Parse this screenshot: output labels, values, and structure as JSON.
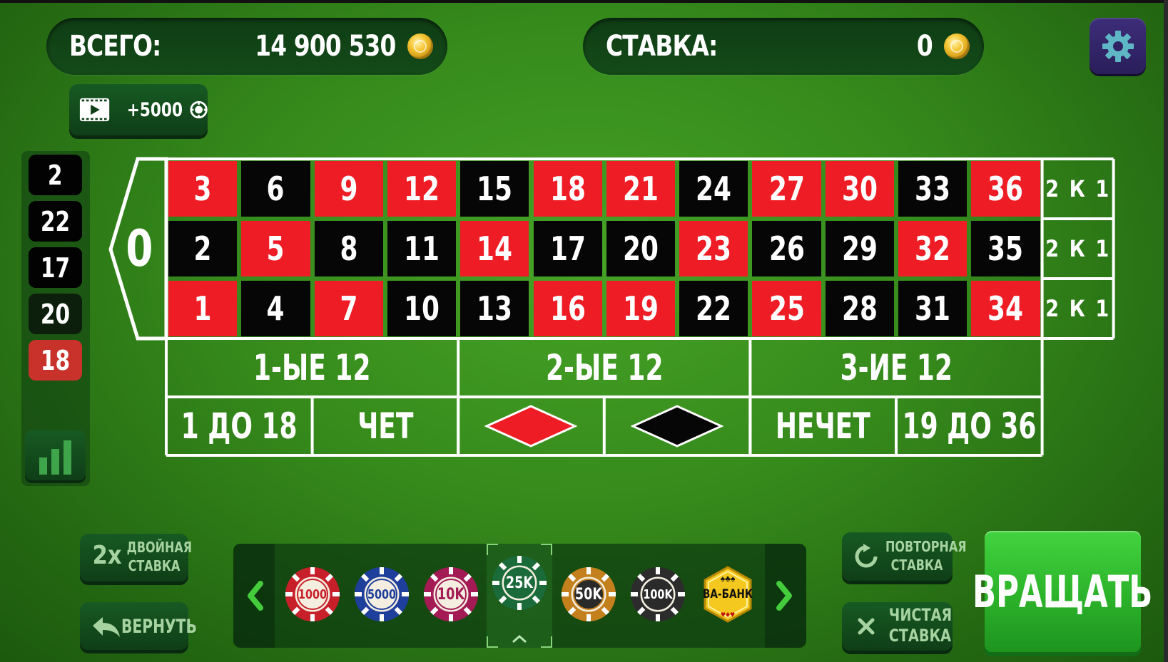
{
  "header": {
    "total_label": "ВСЕГО:",
    "total_value": "14 900 530",
    "bet_label": "СТАВКА:",
    "bet_value": "0"
  },
  "icons": {
    "settings": "gear-icon",
    "video": "video-play-icon",
    "chip_small": "chip-icon",
    "coin": "gold-coin-icon",
    "stats": "bar-chart-icon",
    "undo": "undo-arrow-icon",
    "repeat": "repeat-icon",
    "clear": "close-icon",
    "prev": "chevron-left-icon",
    "next": "chevron-right-icon",
    "up": "chevron-up-icon"
  },
  "reward": {
    "label": "+5000"
  },
  "history": [
    {
      "value": "2",
      "color": "black"
    },
    {
      "value": "22",
      "color": "black"
    },
    {
      "value": "17",
      "color": "black"
    },
    {
      "value": "20",
      "color": "black"
    },
    {
      "value": "18",
      "color": "red"
    }
  ],
  "board": {
    "zero": "0",
    "rows": [
      [
        {
          "n": "3",
          "c": "red"
        },
        {
          "n": "6",
          "c": "black"
        },
        {
          "n": "9",
          "c": "red"
        },
        {
          "n": "12",
          "c": "red"
        },
        {
          "n": "15",
          "c": "black"
        },
        {
          "n": "18",
          "c": "red"
        },
        {
          "n": "21",
          "c": "red"
        },
        {
          "n": "24",
          "c": "black"
        },
        {
          "n": "27",
          "c": "red"
        },
        {
          "n": "30",
          "c": "red"
        },
        {
          "n": "33",
          "c": "black"
        },
        {
          "n": "36",
          "c": "red"
        }
      ],
      [
        {
          "n": "2",
          "c": "black"
        },
        {
          "n": "5",
          "c": "red"
        },
        {
          "n": "8",
          "c": "black"
        },
        {
          "n": "11",
          "c": "black"
        },
        {
          "n": "14",
          "c": "red"
        },
        {
          "n": "17",
          "c": "black"
        },
        {
          "n": "20",
          "c": "black"
        },
        {
          "n": "23",
          "c": "red"
        },
        {
          "n": "26",
          "c": "black"
        },
        {
          "n": "29",
          "c": "black"
        },
        {
          "n": "32",
          "c": "red"
        },
        {
          "n": "35",
          "c": "black"
        }
      ],
      [
        {
          "n": "1",
          "c": "red"
        },
        {
          "n": "4",
          "c": "black"
        },
        {
          "n": "7",
          "c": "red"
        },
        {
          "n": "10",
          "c": "black"
        },
        {
          "n": "13",
          "c": "black"
        },
        {
          "n": "16",
          "c": "red"
        },
        {
          "n": "19",
          "c": "red"
        },
        {
          "n": "22",
          "c": "black"
        },
        {
          "n": "25",
          "c": "red"
        },
        {
          "n": "28",
          "c": "black"
        },
        {
          "n": "31",
          "c": "black"
        },
        {
          "n": "34",
          "c": "red"
        }
      ]
    ],
    "column_bets": [
      "2 К 1",
      "2 К 1",
      "2 К 1"
    ],
    "dozens": [
      "1-ЫЕ 12",
      "2-ЫЕ 12",
      "3-ИЕ 12"
    ],
    "even_money": [
      "1 ДО 18",
      "ЧЕТ",
      "",
      "",
      "НЕЧЕТ",
      "19 ДО 36"
    ]
  },
  "buttons": {
    "double_prefix": "2x",
    "double_line1": "ДВОЙНАЯ",
    "double_line2": "СТАВКА",
    "undo": "ВЕРНУТЬ",
    "repeat_line1": "ПОВТОРНАЯ",
    "repeat_line2": "СТАВКА",
    "clear_line1": "ЧИСТАЯ",
    "clear_line2": "СТАВКА",
    "spin": "ВРАЩАТЬ"
  },
  "chips": [
    {
      "label": "1000",
      "color": "#c8202a"
    },
    {
      "label": "5000",
      "color": "#1f3f9c"
    },
    {
      "label": "10K",
      "color": "#a31a55"
    },
    {
      "label": "25K",
      "color": "#1b6b3a"
    },
    {
      "label": "50K",
      "color": "#c4801c"
    },
    {
      "label": "100K",
      "color": "#2c2c2c"
    },
    {
      "label": "ВА-БАНК",
      "color": "#f1c21b"
    }
  ],
  "selected_chip": "25K",
  "colors": {
    "red": "#ee1c25",
    "black": "#060606",
    "felt": "#3a8f20"
  }
}
